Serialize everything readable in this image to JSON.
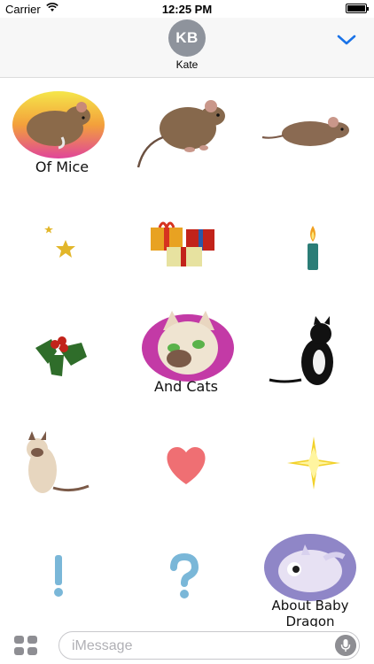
{
  "status_bar": {
    "carrier": "Carrier",
    "time": "12:25 PM"
  },
  "header": {
    "avatar_initials": "KB",
    "contact_name": "Kate"
  },
  "stickers": [
    {
      "name": "mouse-badge-sticker",
      "caption": "Of  Mice"
    },
    {
      "name": "mouse-standing-sticker",
      "caption": ""
    },
    {
      "name": "mouse-running-sticker",
      "caption": ""
    },
    {
      "name": "stars-sticker",
      "caption": ""
    },
    {
      "name": "gifts-sticker",
      "caption": ""
    },
    {
      "name": "candle-sticker",
      "caption": ""
    },
    {
      "name": "holly-sticker",
      "caption": ""
    },
    {
      "name": "cat-badge-sticker",
      "caption": "And Cats"
    },
    {
      "name": "tuxedo-cat-sticker",
      "caption": ""
    },
    {
      "name": "siamese-cat-sticker",
      "caption": ""
    },
    {
      "name": "heart-sticker",
      "caption": ""
    },
    {
      "name": "sparkle-sticker",
      "caption": ""
    },
    {
      "name": "exclamation-sticker",
      "caption": ""
    },
    {
      "name": "question-sticker",
      "caption": ""
    },
    {
      "name": "dragon-badge-sticker",
      "caption": "About Baby Dragon"
    }
  ],
  "compose": {
    "placeholder": "iMessage"
  },
  "colors": {
    "accent": "#1a73e8",
    "avatar_bg": "#8e939c",
    "header_bg": "#f7f7f7"
  }
}
